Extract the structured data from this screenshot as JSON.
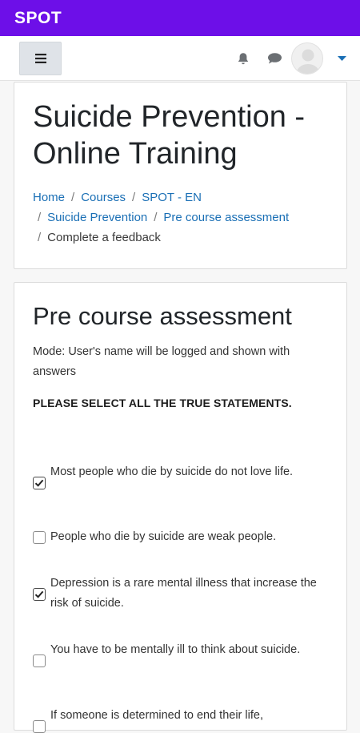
{
  "app": {
    "title": "SPOT"
  },
  "colors": {
    "brand": "#6d0fe8",
    "link": "#1a6fb5"
  },
  "nav": {
    "menu_icon": "hamburger-icon",
    "bell_icon": "bell-icon",
    "chat_icon": "chat-icon",
    "avatar_icon": "user-avatar",
    "dropdown_icon": "caret-down-icon"
  },
  "course": {
    "title": "Suicide Prevention - Online Training",
    "breadcrumbs": [
      "Home",
      "Courses",
      "SPOT - EN",
      "Suicide Prevention",
      "Pre course assessment",
      "Complete a feedback"
    ]
  },
  "feedback": {
    "title": "Pre course assessment",
    "mode": "Mode: User's name will be logged and shown with answers",
    "instruction": "PLEASE SELECT ALL THE TRUE STATEMENTS.",
    "statements": [
      {
        "text": "Most people who die by suicide do not love life.",
        "checked": true
      },
      {
        "text": "People who die by suicide are weak people.",
        "checked": false
      },
      {
        "text": "Depression is a rare mental illness that increase the risk of suicide.",
        "checked": true
      },
      {
        "text": "You have to be mentally ill to think about suicide.",
        "checked": false
      },
      {
        "text": "If someone is determined to end their life,",
        "checked": false
      }
    ]
  }
}
